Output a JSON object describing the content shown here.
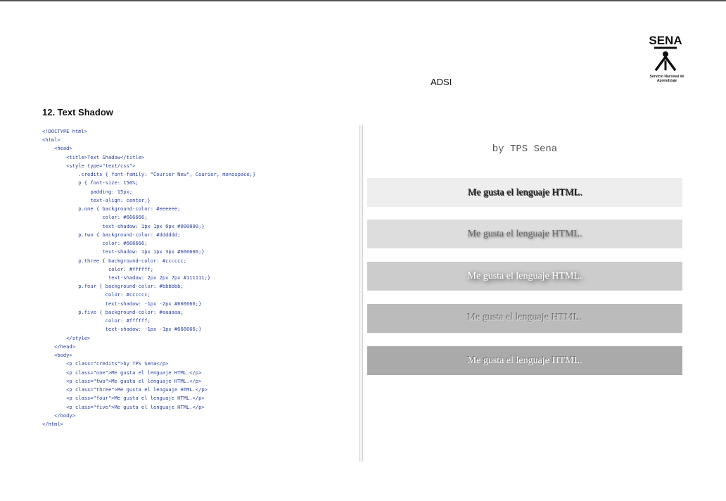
{
  "header": {
    "logo_text": "SENA",
    "logo_subtitle": "Servicio Nacional de Aprendizaje",
    "title": "ADSI"
  },
  "section": {
    "title": "12. Text Shadow"
  },
  "code_lines": [
    "<!DOCTYPE html>",
    "<html>",
    "    <head>",
    "        <title>Text Shadow</title>",
    "        <style type=\"text/css\">",
    "            .credits { font-family: \"Courier New\", Courier, monospace;}",
    "            p { font-size: 150%;",
    "                padding: 15px;",
    "                text-align: center;}",
    "            p.one { background-color: #eeeeee;",
    "                    color: #666666;",
    "                    text-shadow: 1px 1px 0px #000000;}",
    "            p.two { background-color: #dddddd;",
    "                    color: #666666;",
    "                    text-shadow: 1px 1px 3px #666666;}",
    "            p.three { background-color: #cccccc;",
    "                      color: #ffffff;",
    "                      text-shadow: 2px 2px 7px #111111;}",
    "            p.four { background-color: #bbbbbb;",
    "                     color: #cccccc;",
    "                     text-shadow: -1px -2px #666666;}",
    "            p.five { background-color: #aaaaaa;",
    "                     color: #ffffff;",
    "                     text-shadow: -1px -1px #666666;}",
    "        </style>",
    "    </head>",
    "    <body>",
    "        <p class=\"credits\">by TPS Sena</p>",
    "        <p class=\"one\">Me gusta el lenguaje HTML.</p>",
    "        <p class=\"two\">Me gusta el lenguaje HTML.</p>",
    "        <p class=\"three\">Me gusta el lenguaje HTML.</p>",
    "        <p class=\"four\">Me gusta el lenguaje HTML.</p>",
    "        <p class=\"five\">Me gusta el lenguaje HTML.</p>",
    "    </body>",
    "</html>"
  ],
  "preview": {
    "credits": "by TPS Sena",
    "paragraphs": [
      "Me gusta el lenguaje HTML.",
      "Me gusta el lenguaje HTML.",
      "Me gusta el lenguaje HTML.",
      "Me gusta el lenguaje HTML.",
      "Me gusta el lenguaje HTML."
    ]
  },
  "colors": {
    "one_bg": "#eeeeee",
    "two_bg": "#dddddd",
    "three_bg": "#cccccc",
    "four_bg": "#bbbbbb",
    "five_bg": "#aaaaaa"
  }
}
